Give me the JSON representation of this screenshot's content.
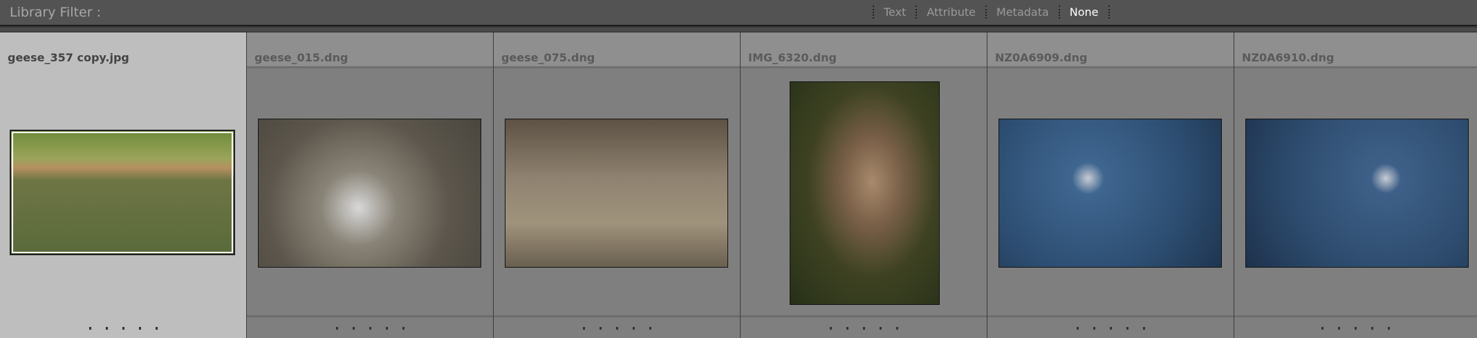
{
  "filter_bar": {
    "label": "Library Filter :",
    "options": [
      {
        "label": "Text"
      },
      {
        "label": "Attribute"
      },
      {
        "label": "Metadata"
      },
      {
        "label": "None",
        "active": true
      }
    ]
  },
  "grid": {
    "cells": [
      {
        "filename": "geese_357 copy.jpg",
        "selected": true
      },
      {
        "filename": "geese_015.dng"
      },
      {
        "filename": "geese_075.dng"
      },
      {
        "filename": "IMG_6320.dng"
      },
      {
        "filename": "NZ0A6909.dng"
      },
      {
        "filename": "NZ0A6910.dng"
      }
    ]
  }
}
